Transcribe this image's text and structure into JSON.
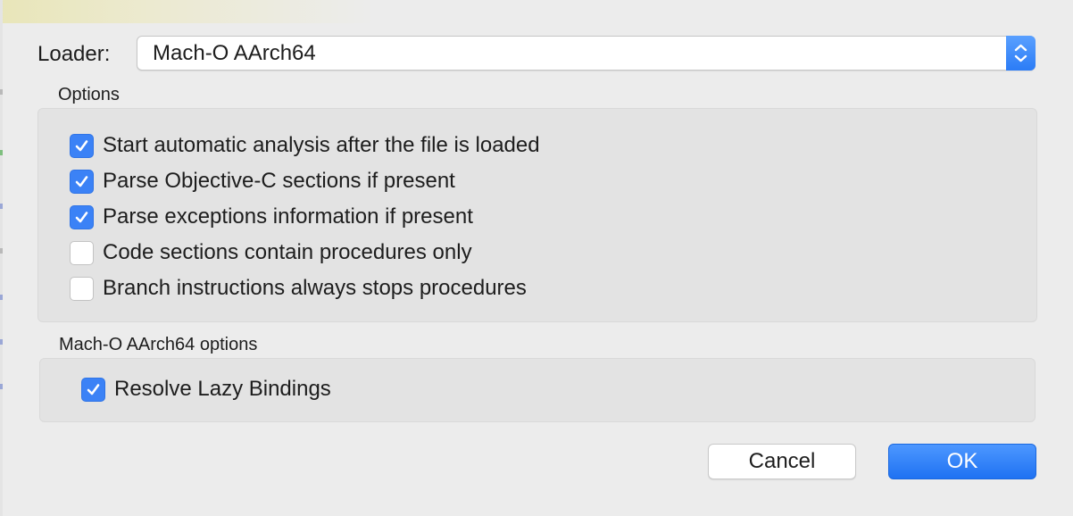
{
  "loader": {
    "label": "Loader:",
    "selected": "Mach-O AArch64"
  },
  "options": {
    "title": "Options",
    "items": [
      {
        "label": "Start automatic analysis after the file is loaded",
        "checked": true
      },
      {
        "label": "Parse Objective-C sections if present",
        "checked": true
      },
      {
        "label": "Parse exceptions information if present",
        "checked": true
      },
      {
        "label": "Code sections contain procedures only",
        "checked": false
      },
      {
        "label": "Branch instructions always stops procedures",
        "checked": false
      }
    ]
  },
  "macho_options": {
    "title": "Mach-O AArch64 options",
    "items": [
      {
        "label": "Resolve Lazy Bindings",
        "checked": true
      }
    ]
  },
  "buttons": {
    "cancel": "Cancel",
    "ok": "OK"
  },
  "colors": {
    "accent": "#3b82f6",
    "background": "#ececec",
    "group_background": "#e3e3e3"
  },
  "icons": {
    "stepper": "up-down-chevron-icon",
    "check": "checkmark-icon"
  }
}
